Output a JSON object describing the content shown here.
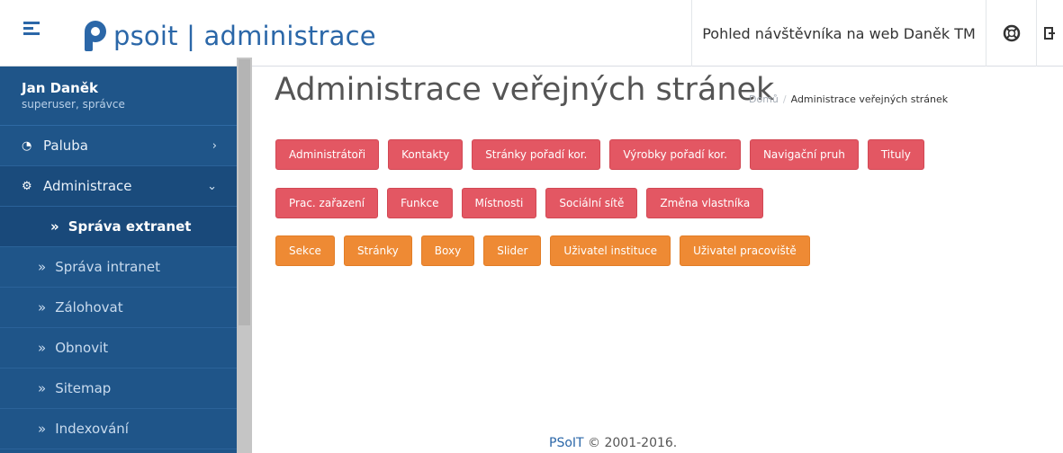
{
  "header": {
    "logo_text": "psoit | administrace",
    "visitor_link": "Pohled návštěvníka na web Daněk TM"
  },
  "user": {
    "name": "Jan Daněk",
    "role": "superuser, správce"
  },
  "sidebar": {
    "items": [
      {
        "label": "Paluba",
        "icon": "dashboard-icon"
      },
      {
        "label": "Administrace",
        "icon": "gear-icon"
      }
    ],
    "subitems": [
      {
        "label": "Správa extranet",
        "active": true
      },
      {
        "label": "Správa intranet"
      },
      {
        "label": "Zálohovat"
      },
      {
        "label": "Obnovit"
      },
      {
        "label": "Sitemap"
      },
      {
        "label": "Indexování"
      }
    ]
  },
  "main": {
    "title": "Administrace veřejných stránek",
    "breadcrumb": {
      "home": "Domů",
      "current": "Administrace veřejných stránek"
    },
    "row1": [
      "Administrátoři",
      "Kontakty",
      "Stránky pořadí kor.",
      "Výrobky pořadí kor.",
      "Navigační pruh",
      "Tituly"
    ],
    "row2": [
      "Prac. zařazení",
      "Funkce",
      "Místnosti",
      "Sociální sítě",
      "Změna vlastníka"
    ],
    "row3": [
      "Sekce",
      "Stránky",
      "Boxy",
      "Slider",
      "Uživatel instituce",
      "Uživatel pracoviště"
    ]
  },
  "footer": {
    "brand": "PSoIT",
    "copyright": "© 2001-2016."
  },
  "colors": {
    "primary": "#1f5589",
    "red_button": "#e35763",
    "orange_button": "#ee8a34",
    "link": "#2b67a8"
  }
}
